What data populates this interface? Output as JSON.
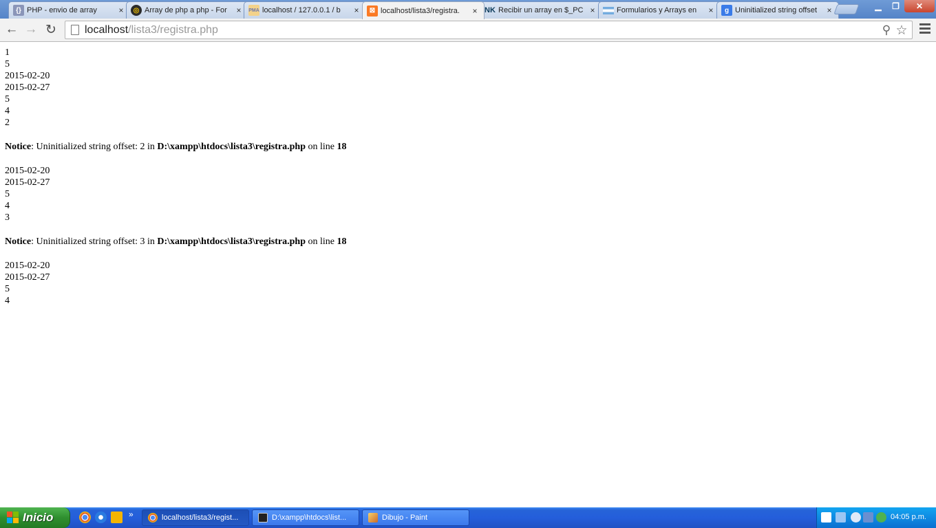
{
  "tabs": [
    {
      "title": "PHP - envio de array",
      "icon": "php-forum-icon"
    },
    {
      "title": "Array de php a php - For",
      "icon": "forum-icon"
    },
    {
      "title": "localhost / 127.0.0.1 / b",
      "icon": "phpmyadmin-icon",
      "icon_text": "PMA"
    },
    {
      "title": "localhost/lista3/registra.",
      "icon": "xampp-icon",
      "active": true
    },
    {
      "title": "Recibir un array en $_PC",
      "icon": "nk-icon",
      "icon_text": "NK"
    },
    {
      "title": "Formularios y Arrays en",
      "icon": "argentina-flag-icon"
    },
    {
      "title": "Uninitialized string offset",
      "icon": "google-icon",
      "icon_text": "g"
    }
  ],
  "tab_close_glyph": "×",
  "window_controls": {
    "minimize": "▁",
    "restore": "❐",
    "close": "✕"
  },
  "toolbar": {
    "back_glyph": "←",
    "forward_glyph": "→",
    "reload_glyph": "↻",
    "url_host": "localhost",
    "url_path": "/lista3/registra.php",
    "search_glyph": "⚲",
    "star_glyph": "☆"
  },
  "page": {
    "block1": [
      "1",
      "5",
      "2015-02-20",
      "2015-02-27",
      "5",
      "4",
      "2"
    ],
    "notice1": {
      "label": "Notice",
      "text_a": ": Uninitialized string offset: 2 in ",
      "file": "D:\\xampp\\htdocs\\lista3\\registra.php",
      "text_b": " on line ",
      "line": "18"
    },
    "block2": [
      "2015-02-20",
      "2015-02-27",
      "5",
      "4",
      "3"
    ],
    "notice2": {
      "label": "Notice",
      "text_a": ": Uninitialized string offset: 3 in ",
      "file": "D:\\xampp\\htdocs\\lista3\\registra.php",
      "text_b": " on line ",
      "line": "18"
    },
    "block3": [
      "2015-02-20",
      "2015-02-27",
      "5",
      "4"
    ]
  },
  "taskbar": {
    "start_label": "Inicio",
    "quick_launch_more": "»",
    "tasks": [
      {
        "label": "localhost/lista3/regist...",
        "icon": "chrome-icon",
        "active": true
      },
      {
        "label": "D:\\xampp\\htdocs\\list...",
        "icon": "console-icon"
      },
      {
        "label": "Dibujo - Paint",
        "icon": "paint-icon"
      }
    ],
    "clock": "04:05 p.m."
  }
}
